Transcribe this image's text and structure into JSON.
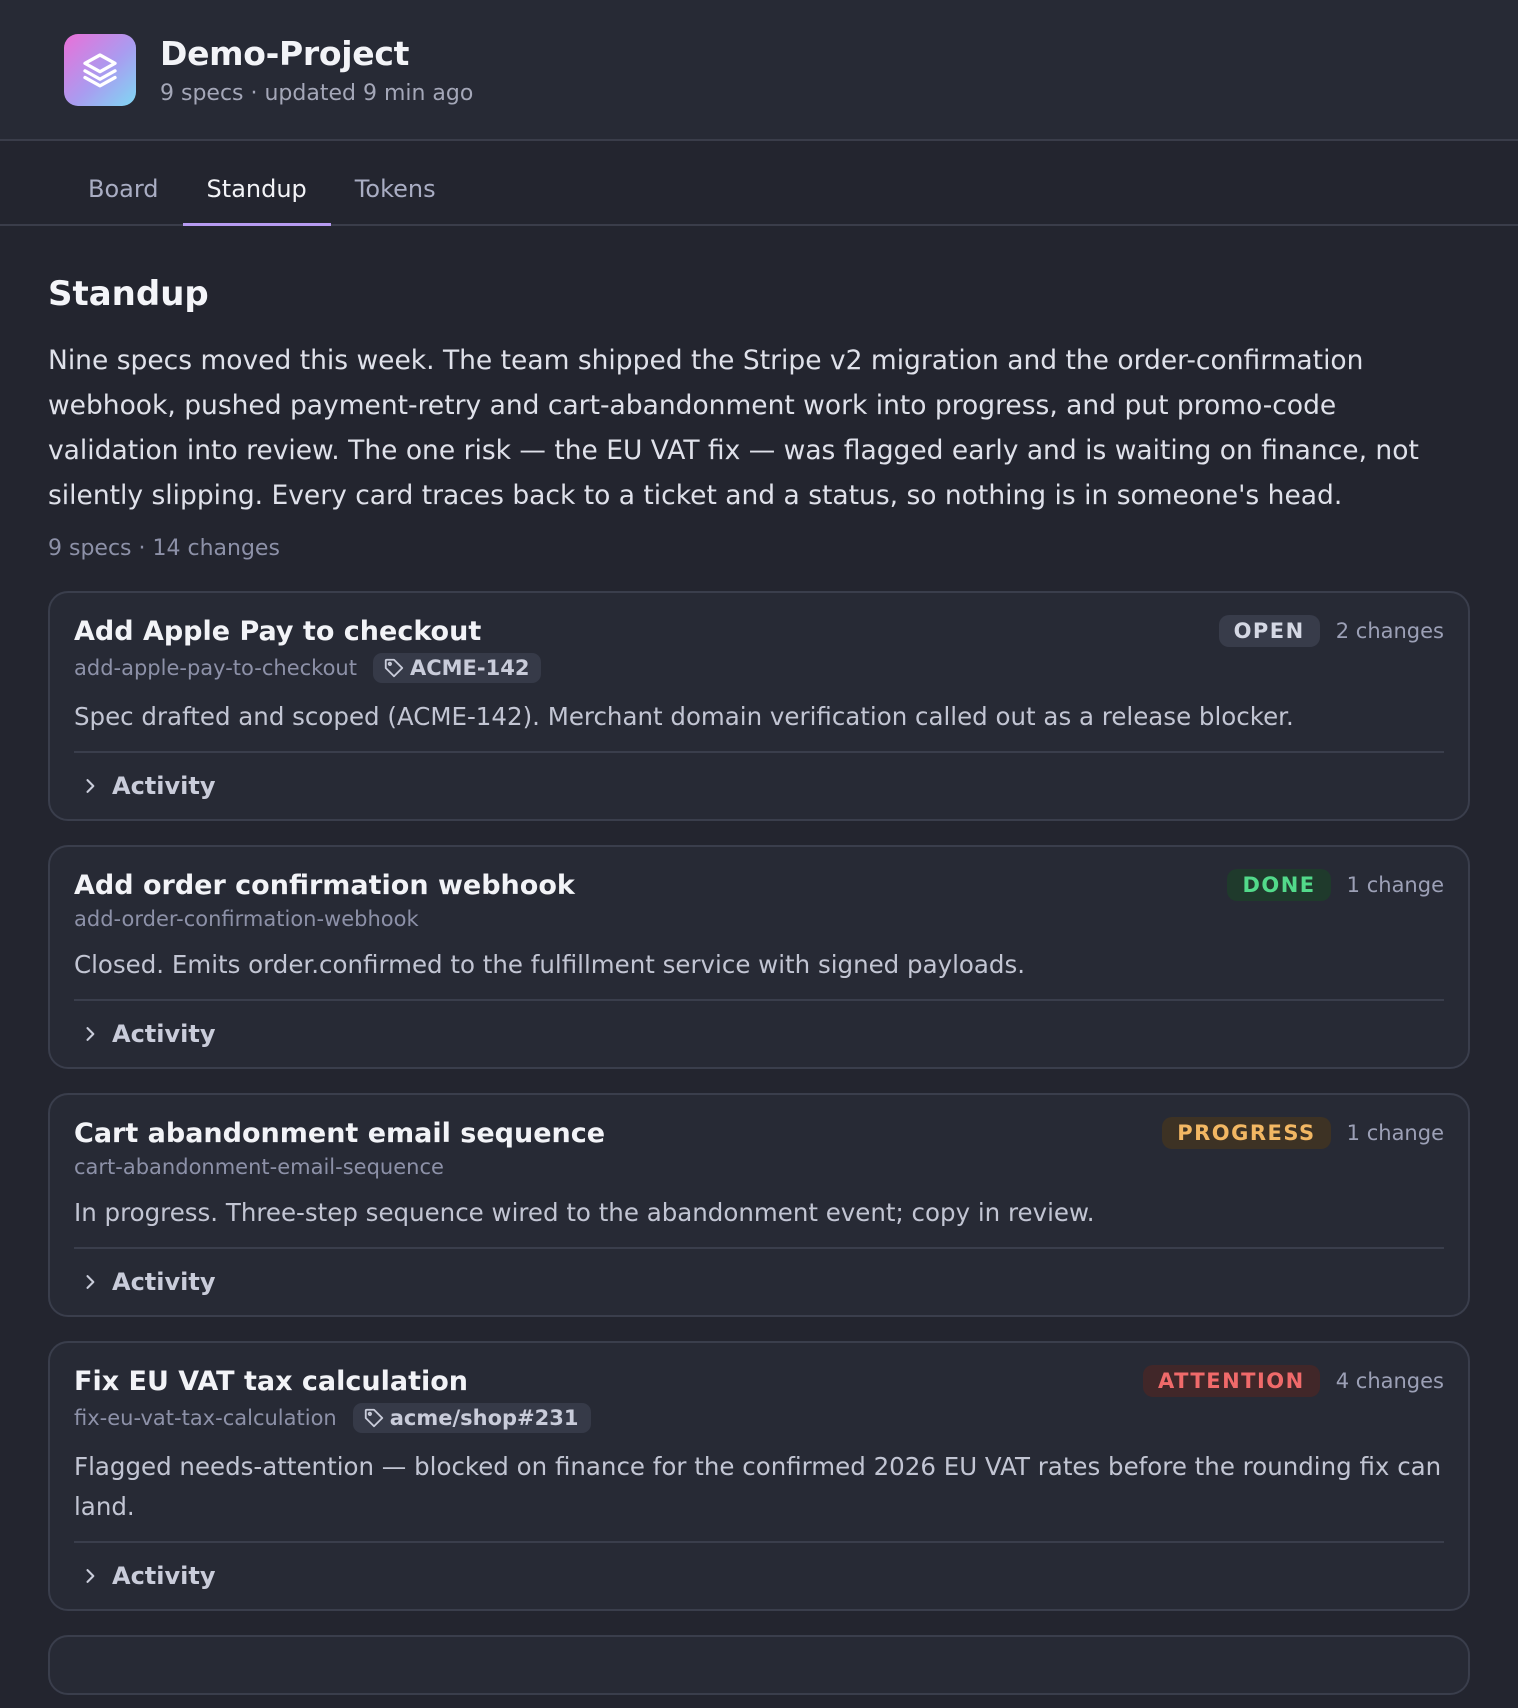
{
  "header": {
    "title": "Demo-Project",
    "subtitle": "9 specs · updated 9 min ago",
    "logo_icon": "stack-layers-icon"
  },
  "tabs": [
    {
      "label": "Board",
      "active": false
    },
    {
      "label": "Standup",
      "active": true
    },
    {
      "label": "Tokens",
      "active": false
    }
  ],
  "main": {
    "title": "Standup",
    "summary": "Nine specs moved this week. The team shipped the Stripe v2 migration and the order-confirmation webhook, pushed payment-retry and cart-abandonment work into progress, and put promo-code validation into review. The one risk — the EU VAT fix — was flagged early and is waiting on finance, not silently slipping. Every card traces back to a ticket and a status, so nothing is in someone's head.",
    "meta": "9 specs · 14 changes"
  },
  "cards": [
    {
      "title": "Add Apple Pay to checkout",
      "slug": "add-apple-pay-to-checkout",
      "ticket": "ACME-142",
      "status": "OPEN",
      "changes": "2 changes",
      "description": "Spec drafted and scoped (ACME-142). Merchant domain verification called out as a release blocker.",
      "activity_label": "Activity"
    },
    {
      "title": "Add order confirmation webhook",
      "slug": "add-order-confirmation-webhook",
      "status": "DONE",
      "changes": "1 change",
      "description": "Closed. Emits order.confirmed to the fulfillment service with signed payloads.",
      "activity_label": "Activity"
    },
    {
      "title": "Cart abandonment email sequence",
      "slug": "cart-abandonment-email-sequence",
      "status": "PROGRESS",
      "changes": "1 change",
      "description": "In progress. Three-step sequence wired to the abandonment event; copy in review.",
      "activity_label": "Activity"
    },
    {
      "title": "Fix EU VAT tax calculation",
      "slug": "fix-eu-vat-tax-calculation",
      "ticket": "acme/shop#231",
      "status": "ATTENTION",
      "changes": "4 changes",
      "description": "Flagged needs-attention — blocked on finance for the confirmed 2026 EU VAT rates before the rounding fix can land.",
      "activity_label": "Activity"
    }
  ],
  "colors": {
    "background": "#23252f",
    "accent": "#b79bf2",
    "status_open": "#d5d8e4",
    "status_done": "#52d98a",
    "status_progress": "#f2b763",
    "status_attention": "#f06a6a"
  }
}
